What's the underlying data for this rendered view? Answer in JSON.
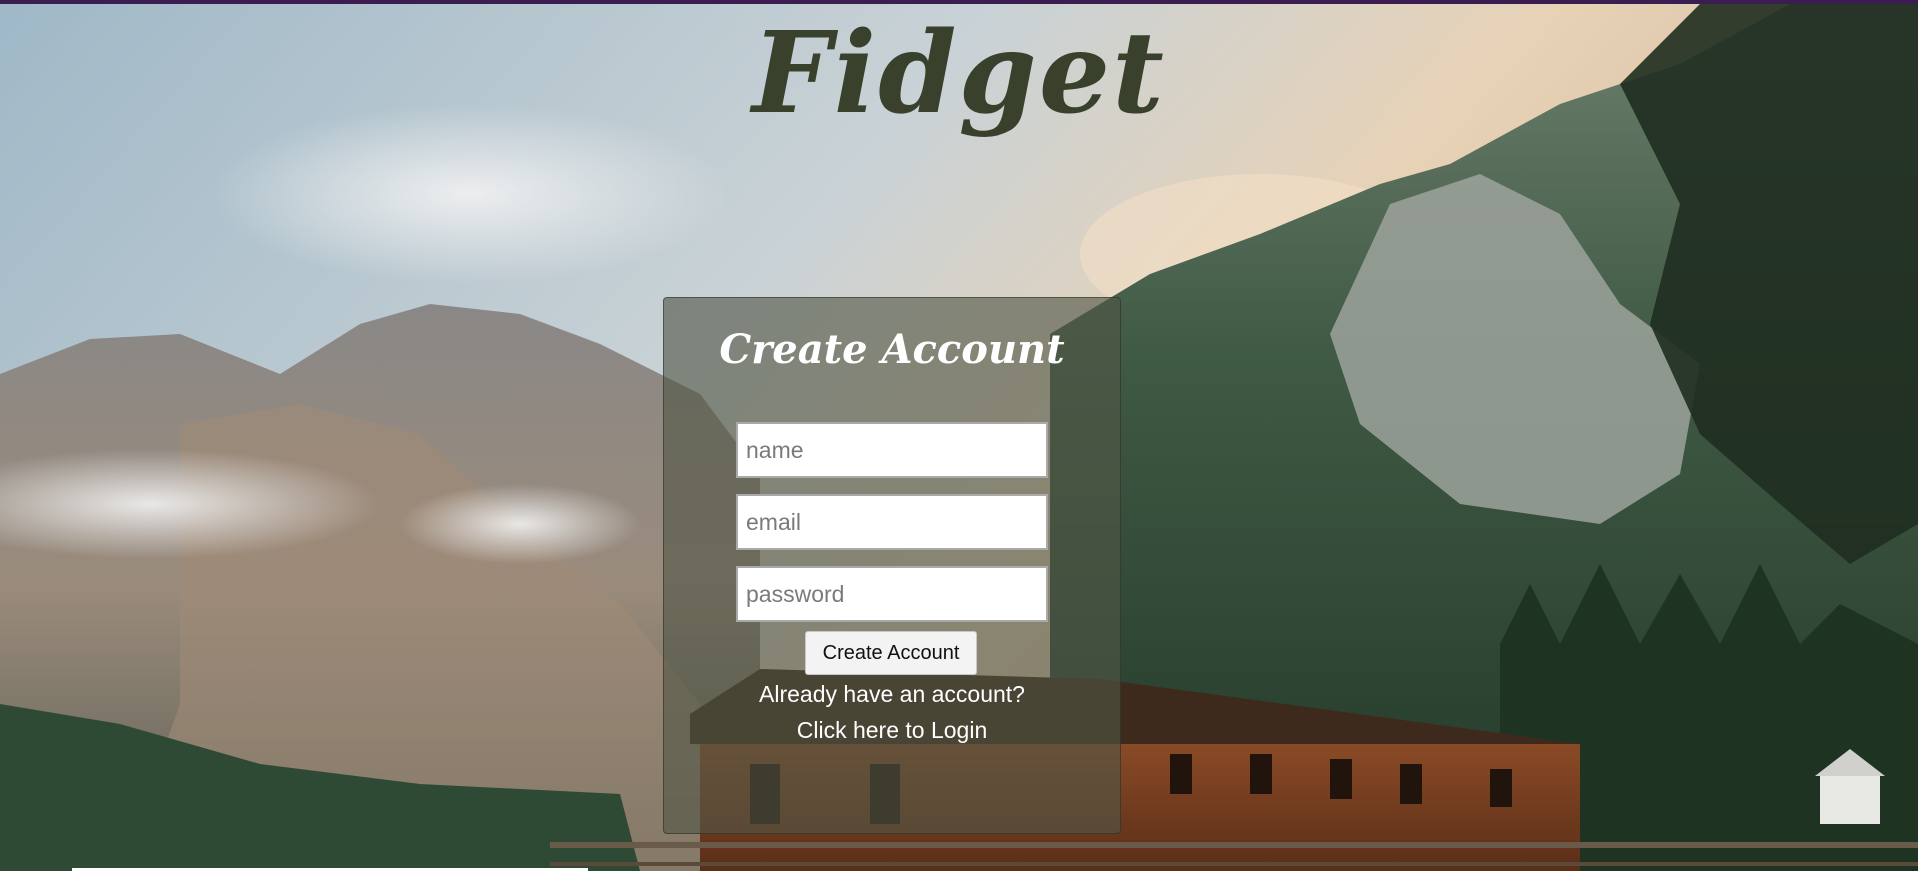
{
  "app": {
    "brand": "Fidget"
  },
  "form": {
    "title": "Create Account",
    "name_placeholder": "name",
    "email_placeholder": "email",
    "password_placeholder": "password",
    "submit_label": "Create Account",
    "login_prompt": "Already have an account?",
    "login_link": "Click here to Login"
  },
  "colors": {
    "top_bar": "#3b1d52",
    "brand_text": "#39402c",
    "panel_overlay": "rgba(80,85,70,0.62)"
  }
}
